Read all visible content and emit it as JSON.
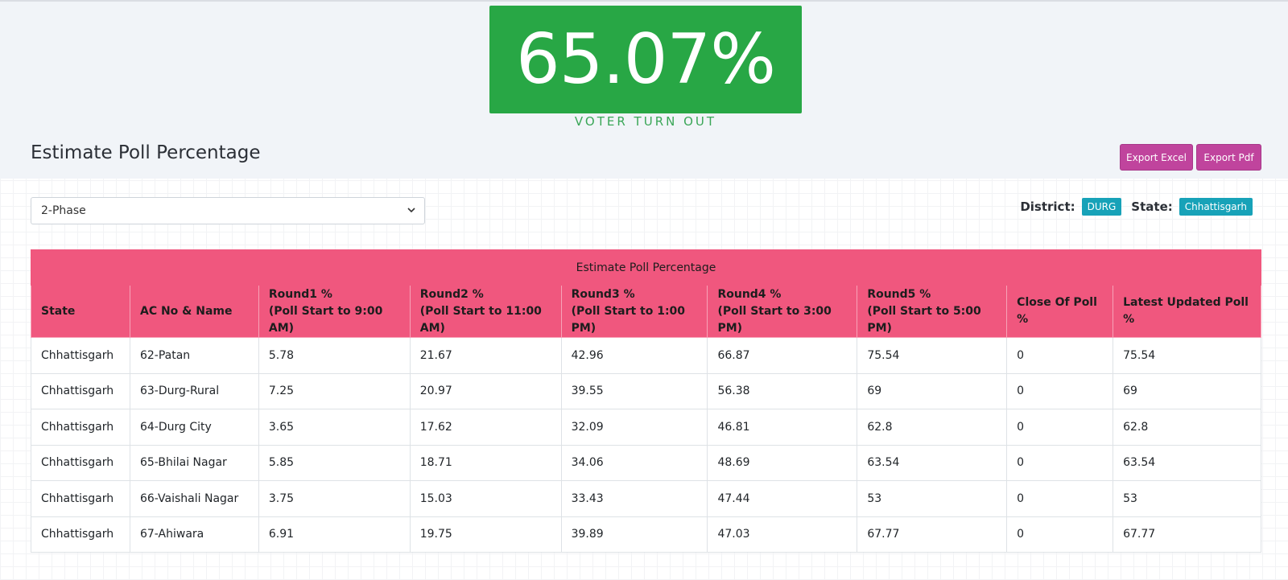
{
  "turnout": {
    "value": "65.07%",
    "label": "VOTER TURN OUT"
  },
  "page": {
    "title": "Estimate Poll Percentage"
  },
  "actions": {
    "export_excel": "Export Excel",
    "export_pdf": "Export Pdf"
  },
  "filter": {
    "phase_selected": "2-Phase"
  },
  "meta": {
    "district_label": "District:",
    "district_value": "DURG",
    "state_label": "State:",
    "state_value": "Chhattisgarh"
  },
  "colors": {
    "accent_green": "#28a745",
    "table_header": "#f0577e",
    "button": "#c0449d",
    "badge": "#17a2b8"
  },
  "table": {
    "caption": "Estimate Poll Percentage",
    "columns": [
      {
        "line1": "State",
        "line2": ""
      },
      {
        "line1": "AC No & Name",
        "line2": ""
      },
      {
        "line1": "Round1 %",
        "line2": "(Poll Start to 9:00 AM)"
      },
      {
        "line1": "Round2 %",
        "line2": "(Poll Start to 11:00 AM)"
      },
      {
        "line1": "Round3 %",
        "line2": "(Poll Start to 1:00 PM)"
      },
      {
        "line1": "Round4 %",
        "line2": "(Poll Start to 3:00 PM)"
      },
      {
        "line1": "Round5 %",
        "line2": "(Poll Start to 5:00 PM)"
      },
      {
        "line1": "Close Of Poll %",
        "line2": ""
      },
      {
        "line1": "Latest Updated Poll %",
        "line2": ""
      }
    ],
    "rows": [
      [
        "Chhattisgarh",
        "62-Patan",
        "5.78",
        "21.67",
        "42.96",
        "66.87",
        "75.54",
        "0",
        "75.54"
      ],
      [
        "Chhattisgarh",
        "63-Durg-Rural",
        "7.25",
        "20.97",
        "39.55",
        "56.38",
        "69",
        "0",
        "69"
      ],
      [
        "Chhattisgarh",
        "64-Durg City",
        "3.65",
        "17.62",
        "32.09",
        "46.81",
        "62.8",
        "0",
        "62.8"
      ],
      [
        "Chhattisgarh",
        "65-Bhilai Nagar",
        "5.85",
        "18.71",
        "34.06",
        "48.69",
        "63.54",
        "0",
        "63.54"
      ],
      [
        "Chhattisgarh",
        "66-Vaishali Nagar",
        "3.75",
        "15.03",
        "33.43",
        "47.44",
        "53",
        "0",
        "53"
      ],
      [
        "Chhattisgarh",
        "67-Ahiwara",
        "6.91",
        "19.75",
        "39.89",
        "47.03",
        "67.77",
        "0",
        "67.77"
      ]
    ]
  }
}
